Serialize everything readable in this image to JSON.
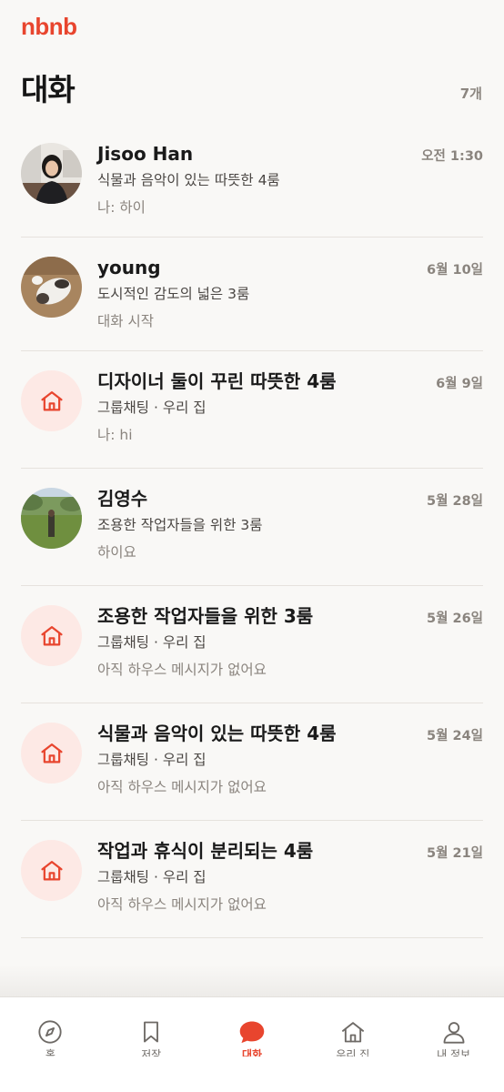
{
  "app": {
    "logo": "nbnb"
  },
  "header": {
    "title": "대화",
    "count": "7개"
  },
  "conversations": [
    {
      "title": "Jisoo Han",
      "subtitle": "식물과 음악이 있는 따뜻한 4룸",
      "message": "나: 하이",
      "time": "오전 1:30",
      "avatar": "photo-woman"
    },
    {
      "title": "young",
      "subtitle": "도시적인 감도의 넓은 3룸",
      "message": "대화 시작",
      "time": "6월 10일",
      "avatar": "photo-cat"
    },
    {
      "title": "디자이너 둘이 꾸린 따뜻한 4룸",
      "subtitle": "그룹채팅 · 우리 집",
      "message": "나: hi",
      "time": "6월 9일",
      "avatar": "house-icon"
    },
    {
      "title": "김영수",
      "subtitle": "조용한 작업자들을 위한 3룸",
      "message": "하이요",
      "time": "5월 28일",
      "avatar": "photo-field"
    },
    {
      "title": "조용한 작업자들을 위한 3룸",
      "subtitle": "그룹채팅 · 우리 집",
      "message": "아직 하우스 메시지가 없어요",
      "time": "5월 26일",
      "avatar": "house-icon"
    },
    {
      "title": "식물과 음악이 있는 따뜻한 4룸",
      "subtitle": "그룹채팅 · 우리 집",
      "message": "아직 하우스 메시지가 없어요",
      "time": "5월 24일",
      "avatar": "house-icon"
    },
    {
      "title": "작업과 휴식이 분리되는 4룸",
      "subtitle": "그룹채팅 · 우리 집",
      "message": "아직 하우스 메시지가 없어요",
      "time": "5월 21일",
      "avatar": "house-icon"
    }
  ],
  "tabbar": [
    {
      "label": "홈",
      "icon": "compass-icon"
    },
    {
      "label": "저장",
      "icon": "bookmark-icon"
    },
    {
      "label": "대화",
      "icon": "chat-bubble-icon",
      "active": true
    },
    {
      "label": "우리 집",
      "icon": "house-icon"
    },
    {
      "label": "내 정보",
      "icon": "person-icon"
    }
  ],
  "colors": {
    "accent": "#e8452e",
    "background": "#f9f8f6",
    "house_avatar_bg": "#fde9e5"
  }
}
